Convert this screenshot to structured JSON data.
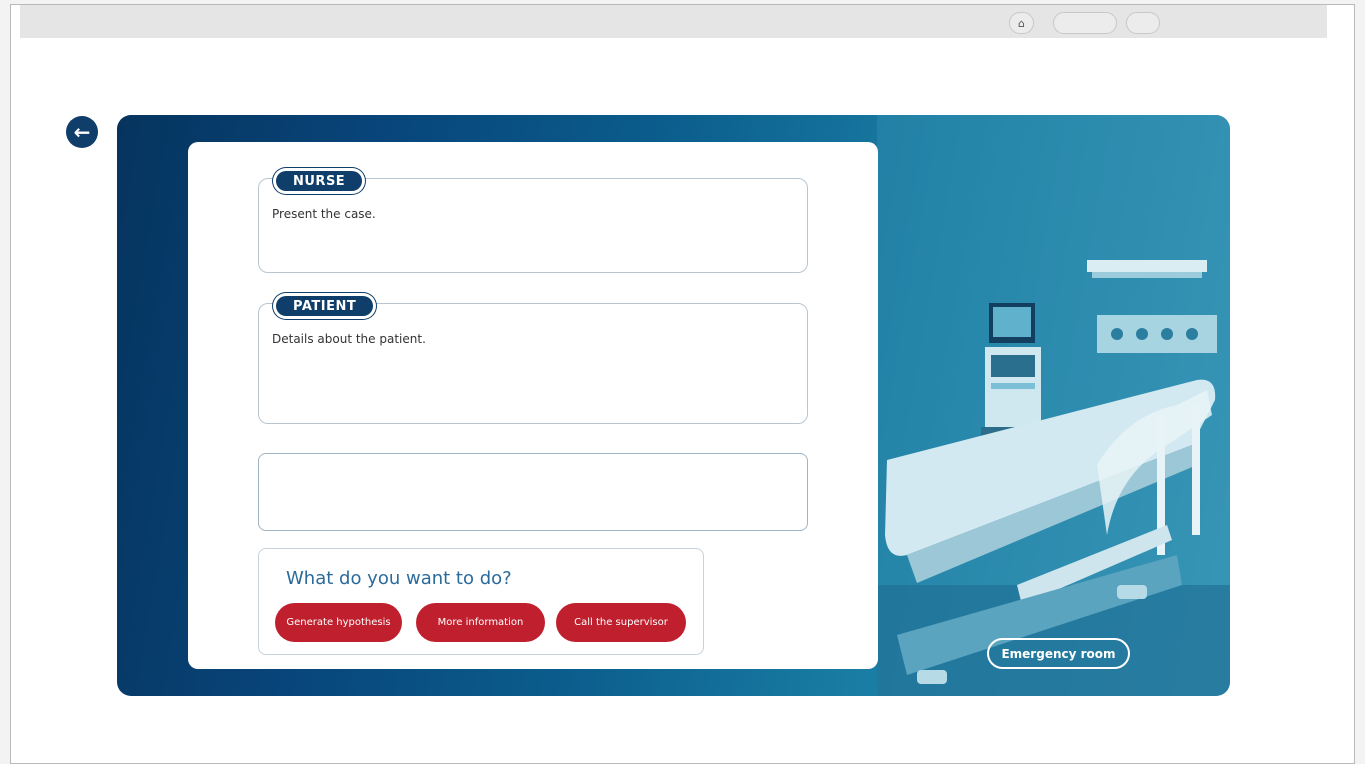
{
  "toolbar": {
    "home_icon": "home-icon",
    "home_glyph": "⌂"
  },
  "back": {
    "icon": "arrow-left-icon",
    "glyph": "←"
  },
  "dialogue": [
    {
      "speaker": "NURSE",
      "text": "Present the case."
    },
    {
      "speaker": "PATIENT",
      "text": "Details about the patient."
    }
  ],
  "response": {
    "value": ""
  },
  "actions": {
    "title": "What do you want to do?",
    "buttons": [
      {
        "label": "Generate hypothesis"
      },
      {
        "label": "More information"
      },
      {
        "label": "Call the supervisor"
      }
    ]
  },
  "location": {
    "label": "Emergency room"
  },
  "colors": {
    "navy": "#0e3e69",
    "accent_red": "#c0202e",
    "title_blue": "#2b6b9b"
  }
}
